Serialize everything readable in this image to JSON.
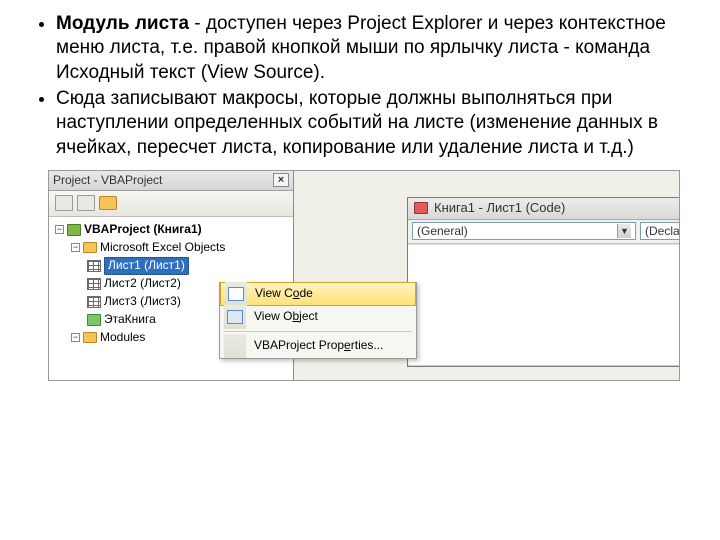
{
  "bullets": {
    "b1_strong": "Модуль листа",
    "b1_rest": " - доступен через Project Explorer и через контекстное меню листа, т.е. правой кнопкой мыши по ярлычку листа - команда Исходный текст (View Source).",
    "b2": "Сюда записывают макросы, которые должны выполняться при наступлении определенных событий на листе (изменение данных в ячейках, пересчет листа, копирование или удаление листа и т.д.)"
  },
  "project_explorer": {
    "title": "Project - VBAProject",
    "close": "×",
    "root": "VBAProject (Книга1)",
    "folder_objects": "Microsoft Excel Objects",
    "sheet1": "Лист1 (Лист1)",
    "sheet2": "Лист2 (Лист2)",
    "sheet3": "Лист3 (Лист3)",
    "thisbook": "ЭтаКнига",
    "folder_modules": "Modules"
  },
  "context_menu": {
    "view_code_pre": "View C",
    "view_code_u": "o",
    "view_code_post": "de",
    "view_object_pre": "View O",
    "view_object_u": "b",
    "view_object_post": "ject",
    "props_pre": "VBAProject Prop",
    "props_u": "e",
    "props_post": "rties..."
  },
  "code_window": {
    "title": "Книга1 - Лист1 (Code)",
    "dd_object": "(General)",
    "dd_proc": "(Declara"
  }
}
